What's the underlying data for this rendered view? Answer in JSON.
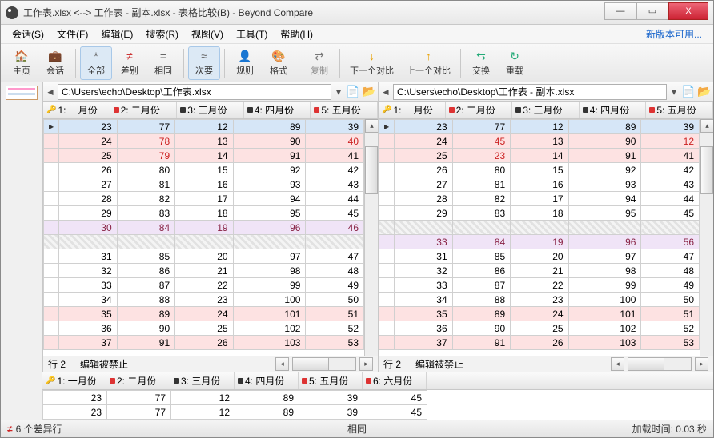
{
  "window": {
    "title": "工作表.xlsx <--> 工作表 - 副本.xlsx - 表格比较(B) - Beyond Compare",
    "min": "—",
    "max": "▭",
    "close": "X"
  },
  "menu": {
    "session": "会话(S)",
    "file": "文件(F)",
    "edit": "编辑(E)",
    "search": "搜索(R)",
    "view": "视图(V)",
    "tools": "工具(T)",
    "help": "帮助(H)",
    "update": "新版本可用..."
  },
  "toolbar": {
    "home": "主页",
    "session": "会话",
    "all": "全部",
    "diff": "差别",
    "same": "相同",
    "minor": "次要",
    "rules": "规则",
    "format": "格式",
    "copy": "复制",
    "nextdiff": "下一个对比",
    "prevdiff": "上一个对比",
    "swap": "交换",
    "reload": "重载"
  },
  "left": {
    "path": "C:\\Users\\echo\\Desktop\\工作表.xlsx",
    "cols": [
      "1: 一月份",
      "2: 二月份",
      "3: 三月份",
      "4: 四月份",
      "5: 五月份"
    ],
    "footer_row": "行 2",
    "footer_lock": "编辑被禁止"
  },
  "right": {
    "path": "C:\\Users\\echo\\Desktop\\工作表 - 副本.xlsx",
    "cols": [
      "1: 一月份",
      "2: 二月份",
      "3: 三月份",
      "4: 四月份",
      "5: 五月份"
    ],
    "footer_row": "行 2",
    "footer_lock": "编辑被禁止"
  },
  "bottom": {
    "cols": [
      "1: 一月份",
      "2: 二月份",
      "3: 三月份",
      "4: 四月份",
      "5: 五月份",
      "6: 六月份"
    ],
    "rows": [
      [
        "23",
        "77",
        "12",
        "89",
        "39",
        "45"
      ],
      [
        "23",
        "77",
        "12",
        "89",
        "39",
        "45"
      ]
    ]
  },
  "chart_data": {
    "type": "table",
    "left_rows": [
      {
        "v": [
          "23",
          "77",
          "12",
          "89",
          "39"
        ],
        "state": "sel"
      },
      {
        "v": [
          "24",
          "78",
          "13",
          "90",
          "40"
        ],
        "state": "diff",
        "chg": [
          1,
          4
        ]
      },
      {
        "v": [
          "25",
          "79",
          "14",
          "91",
          "41"
        ],
        "state": "diff",
        "chg": [
          1
        ]
      },
      {
        "v": [
          "26",
          "80",
          "15",
          "92",
          "42"
        ],
        "state": ""
      },
      {
        "v": [
          "27",
          "81",
          "16",
          "93",
          "43"
        ],
        "state": ""
      },
      {
        "v": [
          "28",
          "82",
          "17",
          "94",
          "44"
        ],
        "state": ""
      },
      {
        "v": [
          "29",
          "83",
          "18",
          "95",
          "45"
        ],
        "state": ""
      },
      {
        "v": [
          "30",
          "84",
          "19",
          "96",
          "46"
        ],
        "state": "uniq",
        "chg": [
          0,
          1,
          2,
          3,
          4
        ]
      },
      {
        "v": [
          "",
          "",
          "",
          "",
          ""
        ],
        "state": "hatch"
      },
      {
        "v": [
          "31",
          "85",
          "20",
          "97",
          "47"
        ],
        "state": ""
      },
      {
        "v": [
          "32",
          "86",
          "21",
          "98",
          "48"
        ],
        "state": ""
      },
      {
        "v": [
          "33",
          "87",
          "22",
          "99",
          "49"
        ],
        "state": ""
      },
      {
        "v": [
          "34",
          "88",
          "23",
          "100",
          "50"
        ],
        "state": ""
      },
      {
        "v": [
          "35",
          "89",
          "24",
          "101",
          "51"
        ],
        "state": "diff"
      },
      {
        "v": [
          "36",
          "90",
          "25",
          "102",
          "52"
        ],
        "state": ""
      },
      {
        "v": [
          "37",
          "91",
          "26",
          "103",
          "53"
        ],
        "state": "diff"
      }
    ],
    "right_rows": [
      {
        "v": [
          "23",
          "77",
          "12",
          "89",
          "39"
        ],
        "state": "sel"
      },
      {
        "v": [
          "24",
          "45",
          "13",
          "90",
          "12"
        ],
        "state": "diff",
        "chg": [
          1,
          4
        ]
      },
      {
        "v": [
          "25",
          "23",
          "14",
          "91",
          "41"
        ],
        "state": "diff",
        "chg": [
          1
        ]
      },
      {
        "v": [
          "26",
          "80",
          "15",
          "92",
          "42"
        ],
        "state": ""
      },
      {
        "v": [
          "27",
          "81",
          "16",
          "93",
          "43"
        ],
        "state": ""
      },
      {
        "v": [
          "28",
          "82",
          "17",
          "94",
          "44"
        ],
        "state": ""
      },
      {
        "v": [
          "29",
          "83",
          "18",
          "95",
          "45"
        ],
        "state": ""
      },
      {
        "v": [
          "",
          "",
          "",
          "",
          ""
        ],
        "state": "hatch"
      },
      {
        "v": [
          "33",
          "84",
          "19",
          "96",
          "56"
        ],
        "state": "uniq",
        "chg": [
          0,
          1,
          2,
          3,
          4
        ]
      },
      {
        "v": [
          "31",
          "85",
          "20",
          "97",
          "47"
        ],
        "state": ""
      },
      {
        "v": [
          "32",
          "86",
          "21",
          "98",
          "48"
        ],
        "state": ""
      },
      {
        "v": [
          "33",
          "87",
          "22",
          "99",
          "49"
        ],
        "state": ""
      },
      {
        "v": [
          "34",
          "88",
          "23",
          "100",
          "50"
        ],
        "state": ""
      },
      {
        "v": [
          "35",
          "89",
          "24",
          "101",
          "51"
        ],
        "state": "diff"
      },
      {
        "v": [
          "36",
          "90",
          "25",
          "102",
          "52"
        ],
        "state": ""
      },
      {
        "v": [
          "37",
          "91",
          "26",
          "103",
          "53"
        ],
        "state": "diff"
      }
    ]
  },
  "status": {
    "diffs": "6 个差异行",
    "mid": "相同",
    "load": "加载时间: 0.03 秒"
  }
}
